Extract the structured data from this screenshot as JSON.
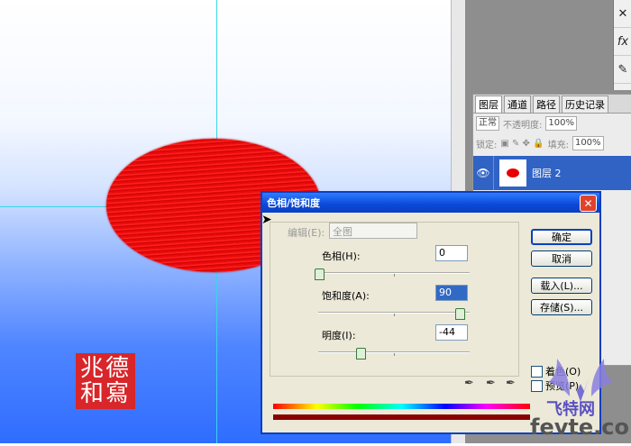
{
  "colors": {
    "accent": "#0a3fc2",
    "petal": "#e80000",
    "seal": "#d8262a"
  },
  "seal": {
    "text": "兆 德 和 寫"
  },
  "tools": [
    "icon-wrench",
    "fx-icon",
    "brush-icon"
  ],
  "layers_panel": {
    "tabs": [
      "图层",
      "通道",
      "路径",
      "历史记录"
    ],
    "blend_mode": "正常",
    "opacity_label": "不透明度:",
    "opacity_value": "100%",
    "lock_label": "锁定:",
    "fill_label": "填充:",
    "fill_value": "100%",
    "layer_name": "图层 2"
  },
  "dialog": {
    "title": "色相/饱和度",
    "edit_label": "编辑(E):",
    "edit_value": "全图",
    "hue_label": "色相(H):",
    "hue_value": "0",
    "hue_fraction": 0.0,
    "saturation_label": "饱和度(A):",
    "saturation_value": "90",
    "saturation_fraction": 0.95,
    "lightness_label": "明度(I):",
    "lightness_value": "-44",
    "lightness_fraction": 0.28,
    "buttons": {
      "ok": "确定",
      "cancel": "取消",
      "load": "载入(L)...",
      "save": "存储(S)..."
    },
    "checkbox_colorize": "着色(O)",
    "checkbox_preview": "预览(P)"
  },
  "watermark": {
    "line1": "飞特网",
    "line2": "fevte.com"
  }
}
